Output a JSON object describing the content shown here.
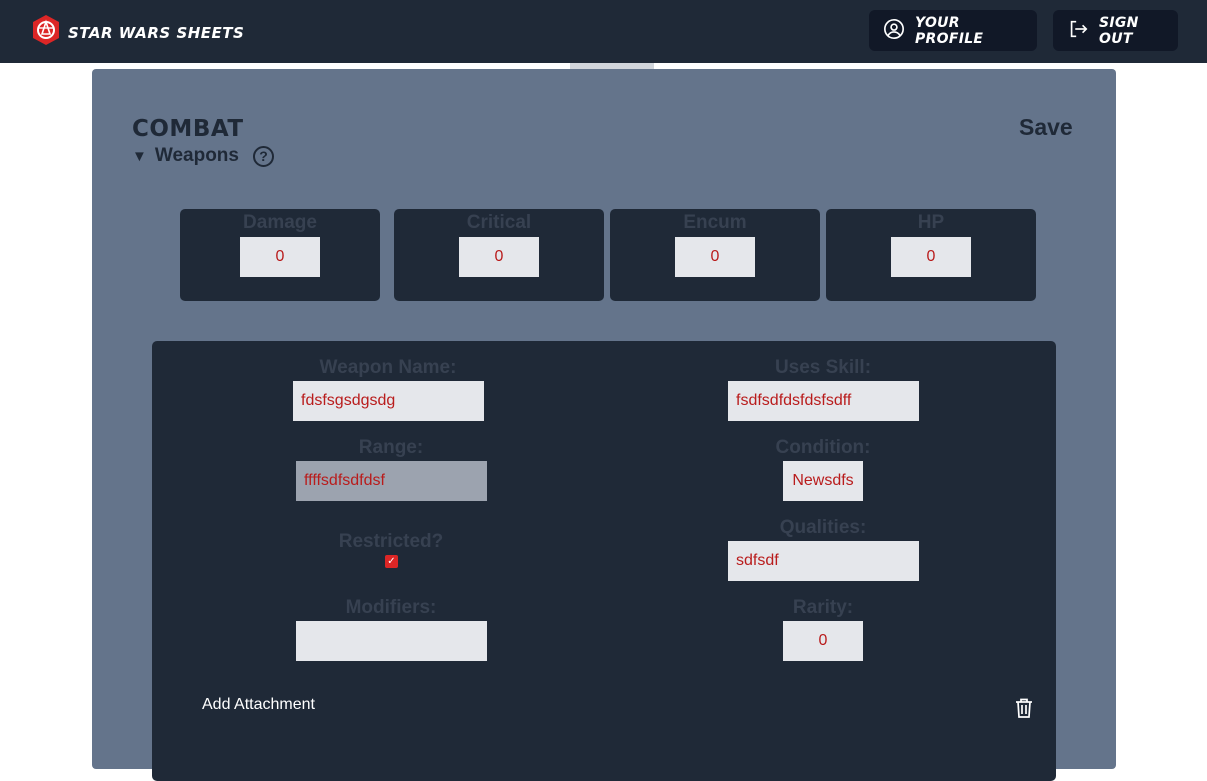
{
  "header": {
    "brand": "STAR WARS SHEETS",
    "profile_label": "YOUR PROFILE",
    "signout_label": "SIGN OUT",
    "icons": {
      "logo": "rebel-logo-icon",
      "profile": "user-circle-icon",
      "signout": "logout-icon"
    }
  },
  "section": {
    "title": "COMBAT",
    "save_label": "Save",
    "subsection": "Weapons",
    "help_glyph": "?"
  },
  "stats": [
    {
      "label": "Damage",
      "value": "0"
    },
    {
      "label": "Critical",
      "value": "0"
    },
    {
      "label": "Encum",
      "value": "0"
    },
    {
      "label": "HP",
      "value": "0"
    }
  ],
  "weapon": {
    "name_label": "Weapon Name:",
    "name_value": "fdsfsgsdgsdg",
    "skill_label": "Uses Skill:",
    "skill_value": "fsdfsdfdsfdsfsdff",
    "range_label": "Range:",
    "range_value": "ffffsdfsdfdsf",
    "condition_label": "Condition:",
    "condition_value": "Newsdfs",
    "restricted_label": "Restricted?",
    "restricted_checked": true,
    "qualities_label": "Qualities:",
    "qualities_value": "sdfsdf",
    "modifiers_label": "Modifiers:",
    "modifiers_value": "",
    "rarity_label": "Rarity:",
    "rarity_value": "0",
    "add_attachment": "Add Attachment"
  },
  "colors": {
    "topbar": "#1f2937",
    "panel": "#64748b",
    "card": "#1f2937",
    "input_text": "#b91c1c",
    "checkbox": "#dc2626"
  }
}
